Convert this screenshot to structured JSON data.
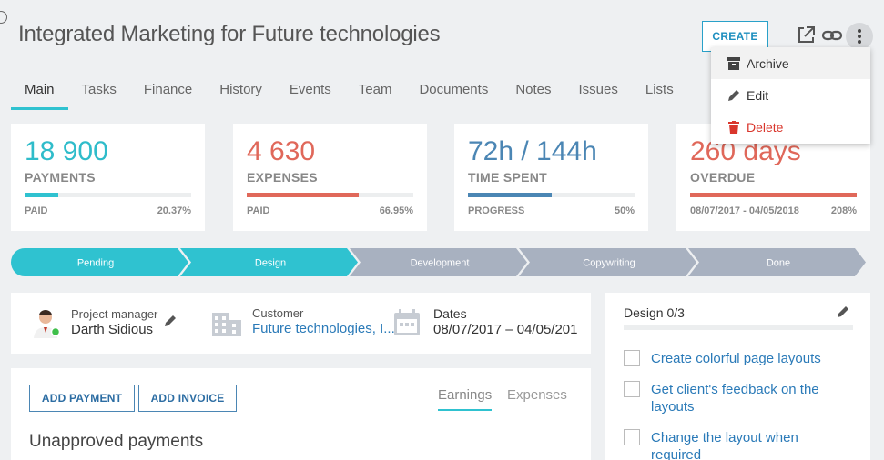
{
  "header": {
    "title": "Integrated Marketing for Future technologies",
    "create_label": "CREATE",
    "icons": [
      "open-external-icon",
      "link-icon",
      "more-vertical-icon"
    ]
  },
  "tabs": [
    {
      "label": "Main",
      "active": true
    },
    {
      "label": "Tasks"
    },
    {
      "label": "Finance"
    },
    {
      "label": "History"
    },
    {
      "label": "Events"
    },
    {
      "label": "Team"
    },
    {
      "label": "Documents"
    },
    {
      "label": "Notes"
    },
    {
      "label": "Issues"
    },
    {
      "label": "Lists"
    }
  ],
  "menu": {
    "archive": "Archive",
    "edit": "Edit",
    "delete": "Delete"
  },
  "cards": [
    {
      "value": "18 900",
      "label": "PAYMENTS",
      "sub_left": "PAID",
      "sub_right": "20.37%",
      "progress": 0.2037,
      "color": "#2fc2d0"
    },
    {
      "value": "4 630",
      "label": "EXPENSES",
      "sub_left": "PAID",
      "sub_right": "66.95%",
      "progress": 0.6695,
      "color": "#e0685a"
    },
    {
      "value": "72h / 144h",
      "label": "TIME SPENT",
      "sub_left": "PROGRESS",
      "sub_right": "50%",
      "progress": 0.5,
      "color": "#4b86b4"
    },
    {
      "value": "260 days",
      "label": "OVERDUE",
      "sub_left": "08/07/2017 - 04/05/2018",
      "sub_right": "208%",
      "progress": 1.0,
      "color": "#e0685a"
    }
  ],
  "pipeline": {
    "stages": [
      "Pending",
      "Design",
      "Development",
      "Copywriting",
      "Done"
    ],
    "completed_count": 2,
    "active_color": "#2fc2d0",
    "inactive_color": "#a8b1c0"
  },
  "info": {
    "manager_label": "Project manager",
    "manager_name": "Darth Sidious",
    "customer_label": "Customer",
    "customer_name": "Future technologies, I...",
    "dates_label": "Dates",
    "dates_value": "08/07/2017 – 04/05/201"
  },
  "finance": {
    "add_payment": "ADD PAYMENT",
    "add_invoice": "ADD INVOICE",
    "tab_earnings": "Earnings",
    "tab_expenses": "Expenses",
    "section_title": "Unapproved payments"
  },
  "checklist": {
    "title": "Design 0/3",
    "items": [
      "Create colorful page layouts",
      "Get client's feedback on the layouts",
      "Change the layout when required"
    ]
  }
}
